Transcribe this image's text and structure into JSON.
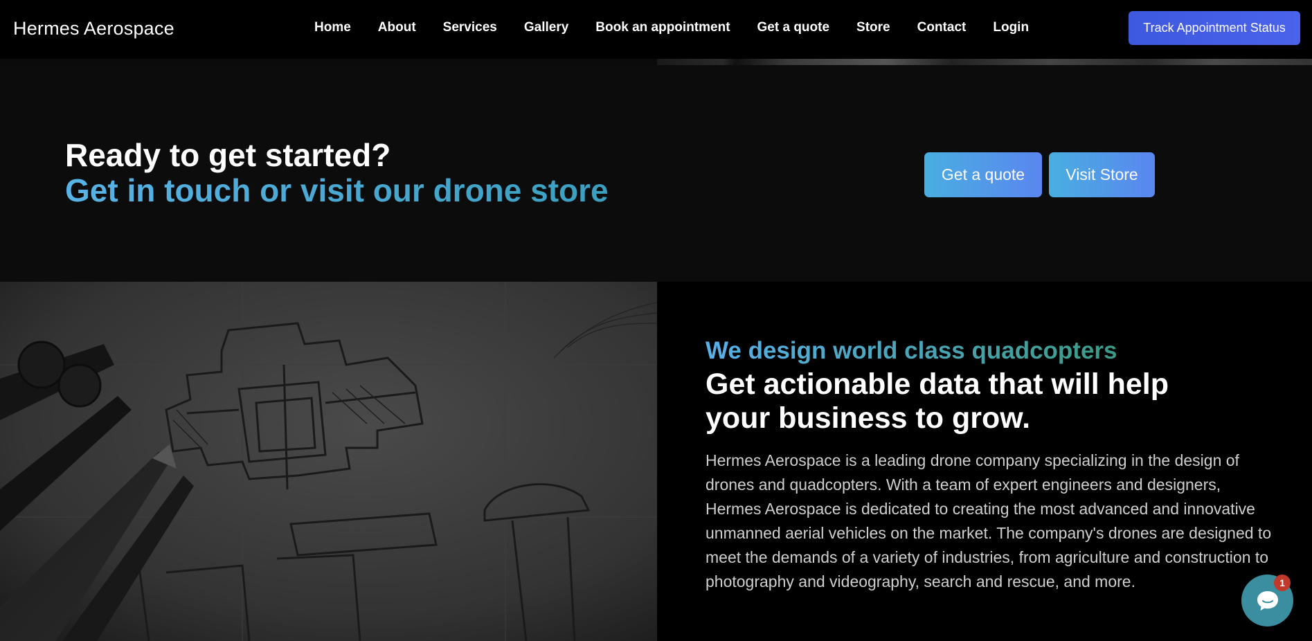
{
  "nav": {
    "brand": "Hermes Aerospace",
    "links": [
      {
        "label": "Home"
      },
      {
        "label": "About"
      },
      {
        "label": "Services"
      },
      {
        "label": "Gallery"
      },
      {
        "label": "Book an appointment"
      },
      {
        "label": "Get a quote"
      },
      {
        "label": "Store"
      },
      {
        "label": "Contact"
      },
      {
        "label": "Login"
      }
    ],
    "track_button": "Track Appointment Status"
  },
  "cta": {
    "title": "Ready to get started?",
    "subtitle": "Get in touch or visit our drone store",
    "quote_button": "Get a quote",
    "store_button": "Visit Store"
  },
  "feature": {
    "kicker": "We design world class quadcopters",
    "headline": "Get actionable data that will help your business to grow.",
    "body": "Hermes Aerospace is a leading drone company specializing in the design of drones and quadcopters. With a team of expert engineers and designers, Hermes Aerospace is dedicated to creating the most advanced and innovative unmanned aerial vehicles on the market. The company's drones are designed to meet the demands of a variety of industries, from agriculture and construction to photography and videography, search and rescue, and more."
  },
  "chat": {
    "icon": "chat-bubble-icon",
    "unread_count": "1"
  },
  "colors": {
    "accent_blue": "#3d59e0",
    "gradient_start": "#49aee0",
    "gradient_end": "#5a86f0",
    "kicker_teal": "#3c9a86"
  }
}
